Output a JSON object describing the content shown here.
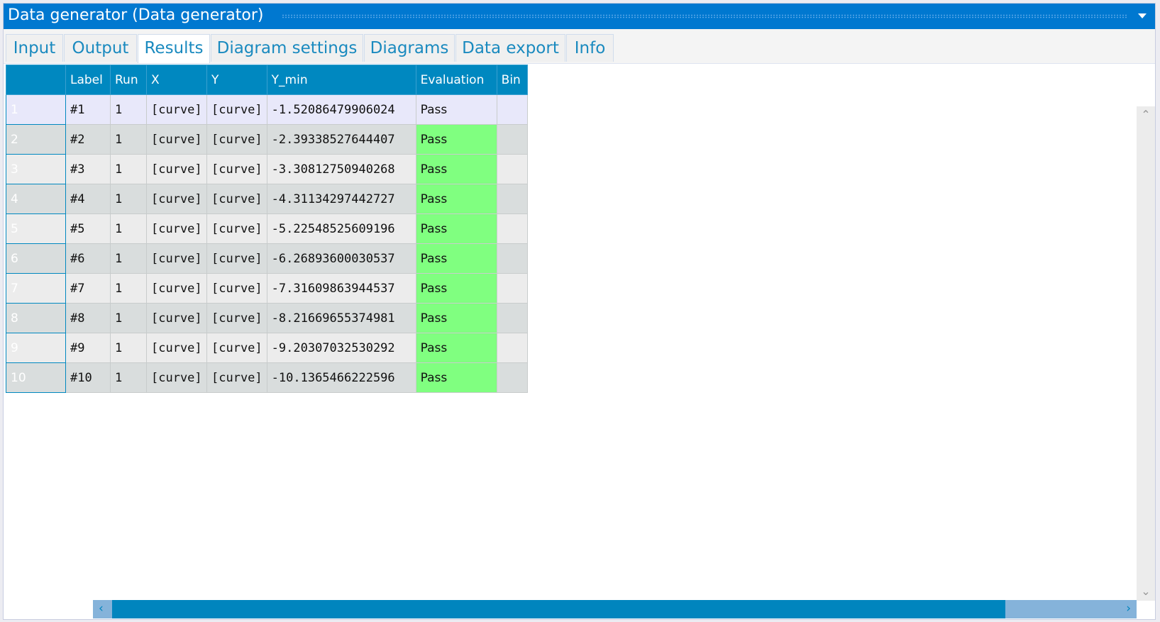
{
  "window": {
    "title": "Data generator (Data generator)"
  },
  "tabs": [
    "Input",
    "Output",
    "Results",
    "Diagram settings",
    "Diagrams",
    "Data export",
    "Info"
  ],
  "active_tab": "Results",
  "table": {
    "columns": [
      "",
      "Label",
      "Run",
      "X",
      "Y",
      "Y_min",
      "Evaluation",
      "Bin"
    ],
    "rows": [
      [
        "1",
        "#1",
        "1",
        "[curve]",
        "[curve]",
        "-1.52086479906024",
        "Pass",
        ""
      ],
      [
        "2",
        "#2",
        "1",
        "[curve]",
        "[curve]",
        "-2.39338527644407",
        "Pass",
        ""
      ],
      [
        "3",
        "#3",
        "1",
        "[curve]",
        "[curve]",
        "-3.30812750940268",
        "Pass",
        ""
      ],
      [
        "4",
        "#4",
        "1",
        "[curve]",
        "[curve]",
        "-4.31134297442727",
        "Pass",
        ""
      ],
      [
        "5",
        "#5",
        "1",
        "[curve]",
        "[curve]",
        "-5.22548525609196",
        "Pass",
        ""
      ],
      [
        "6",
        "#6",
        "1",
        "[curve]",
        "[curve]",
        "-6.26893600030537",
        "Pass",
        ""
      ],
      [
        "7",
        "#7",
        "1",
        "[curve]",
        "[curve]",
        "-7.31609863944537",
        "Pass",
        ""
      ],
      [
        "8",
        "#8",
        "1",
        "[curve]",
        "[curve]",
        "-8.21669655374981",
        "Pass",
        ""
      ],
      [
        "9",
        "#9",
        "1",
        "[curve]",
        "[curve]",
        "-9.20307032530292",
        "Pass",
        ""
      ],
      [
        "10",
        "#10",
        "1",
        "[curve]",
        "[curve]",
        "-10.1365466222596",
        "Pass",
        ""
      ]
    ]
  },
  "colors": {
    "title_bar": "#0078d0",
    "header": "#0088c0",
    "pass": "#80ff80"
  }
}
